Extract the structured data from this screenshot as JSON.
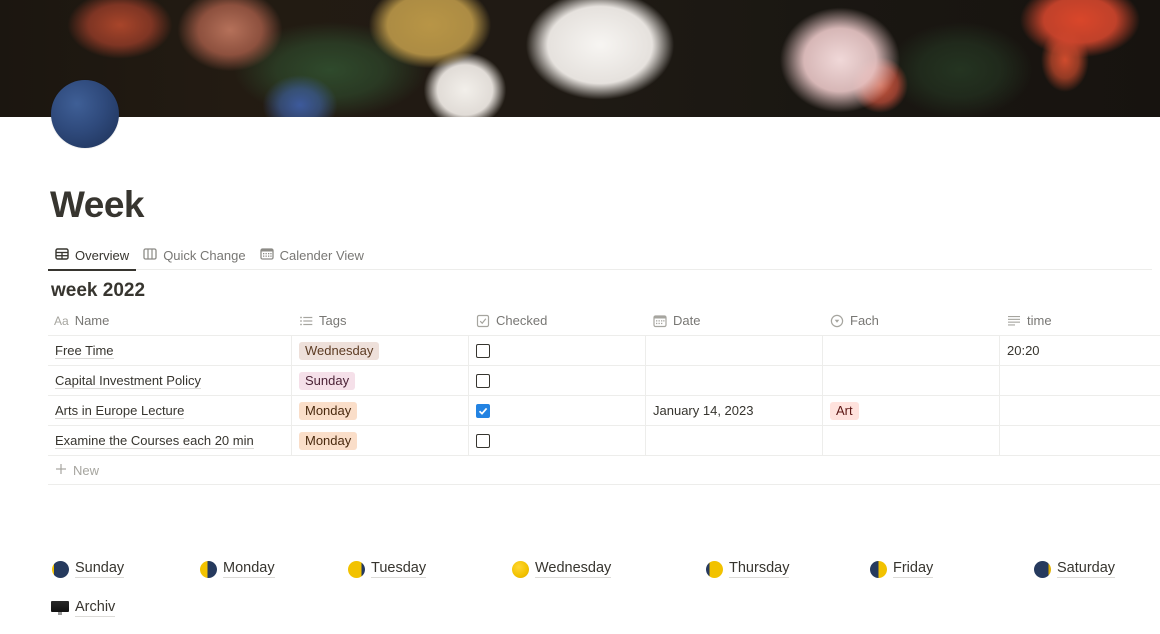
{
  "page": {
    "title": "Week",
    "icon": "new-moon-icon"
  },
  "tabs": [
    {
      "label": "Overview",
      "icon": "table-icon",
      "active": true
    },
    {
      "label": "Quick Change",
      "icon": "board-icon",
      "active": false
    },
    {
      "label": "Calender View",
      "icon": "calendar-icon",
      "active": false
    }
  ],
  "database": {
    "title": "week 2022",
    "columns": [
      {
        "label": "Name",
        "icon": "Aa"
      },
      {
        "label": "Tags",
        "icon": "list-icon"
      },
      {
        "label": "Checked",
        "icon": "checkbox-icon"
      },
      {
        "label": "Date",
        "icon": "calendar-icon"
      },
      {
        "label": "Fach",
        "icon": "select-icon"
      },
      {
        "label": "time",
        "icon": "text-lines-icon"
      }
    ],
    "rows": [
      {
        "name": "Free Time",
        "tag": "Wednesday",
        "tag_bg": "#EEE0DA",
        "tag_fg": "#5C3B23",
        "checked": false,
        "date": "",
        "fach": "",
        "time": "20:20"
      },
      {
        "name": "Capital Investment Policy",
        "tag": "Sunday",
        "tag_bg": "#F5E0E9",
        "tag_fg": "#4C2337",
        "checked": false,
        "date": "",
        "fach": "",
        "time": ""
      },
      {
        "name": "Arts in Europe Lecture",
        "tag": "Monday",
        "tag_bg": "#FADEC9",
        "tag_fg": "#49290E",
        "checked": true,
        "date": "January 14, 2023",
        "fach": "Art",
        "time": ""
      },
      {
        "name": "Examine the Courses each 20 min",
        "tag": "Monday",
        "tag_bg": "#FADEC9",
        "tag_fg": "#49290E",
        "checked": false,
        "date": "",
        "fach": "",
        "time": ""
      }
    ],
    "fach_colors": {
      "Art": {
        "bg": "#FFE2DD",
        "fg": "#5D1715"
      }
    },
    "new_label": "New"
  },
  "day_links": [
    {
      "label": "Sunday",
      "icon": "waning-crescent-moon-icon"
    },
    {
      "label": "Monday",
      "icon": "first-quarter-moon-icon"
    },
    {
      "label": "Tuesday",
      "icon": "waxing-gibbous-moon-icon"
    },
    {
      "label": "Wednesday",
      "icon": "full-moon-icon"
    },
    {
      "label": "Thursday",
      "icon": "last-quarter-moon-icon"
    },
    {
      "label": "Friday",
      "icon": "waning-crescent-moon-icon"
    },
    {
      "label": "Saturday",
      "icon": "new-moon-icon"
    }
  ],
  "archive_link": {
    "label": "Archiv",
    "icon": "desktop-computer-icon"
  },
  "colors": {
    "accent_checkbox": "#2383E2",
    "text": "#37352F",
    "muted": "#787774"
  }
}
